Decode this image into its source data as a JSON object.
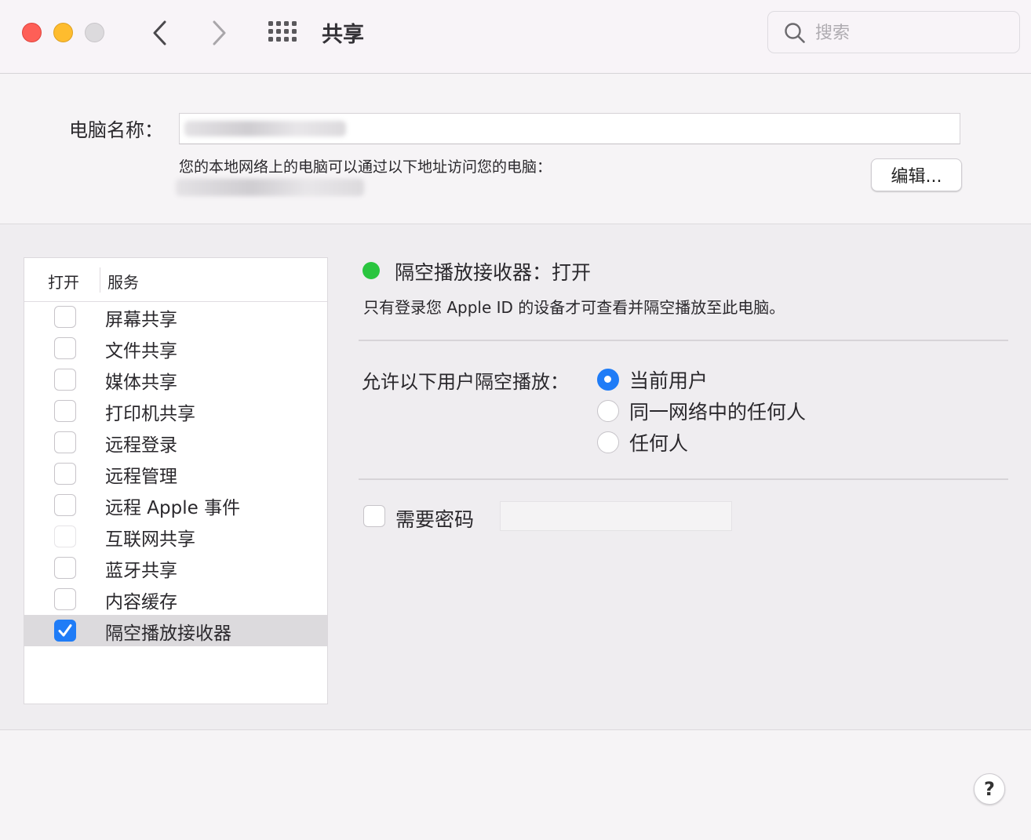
{
  "window": {
    "title": "共享",
    "search_placeholder": "搜索"
  },
  "computer_name": {
    "label": "电脑名称：",
    "value": "",
    "address_note": "您的本地网络上的电脑可以通过以下地址访问您的电脑：",
    "edit_button": "编辑..."
  },
  "services": {
    "header_on": "打开",
    "header_service": "服务",
    "items": [
      {
        "label": "屏幕共享",
        "checked": false,
        "faded": false,
        "selected": false
      },
      {
        "label": "文件共享",
        "checked": false,
        "faded": false,
        "selected": false
      },
      {
        "label": "媒体共享",
        "checked": false,
        "faded": false,
        "selected": false
      },
      {
        "label": "打印机共享",
        "checked": false,
        "faded": false,
        "selected": false
      },
      {
        "label": "远程登录",
        "checked": false,
        "faded": false,
        "selected": false
      },
      {
        "label": "远程管理",
        "checked": false,
        "faded": false,
        "selected": false
      },
      {
        "label": "远程 Apple 事件",
        "checked": false,
        "faded": false,
        "selected": false
      },
      {
        "label": "互联网共享",
        "checked": false,
        "faded": true,
        "selected": false
      },
      {
        "label": "蓝牙共享",
        "checked": false,
        "faded": false,
        "selected": false
      },
      {
        "label": "内容缓存",
        "checked": false,
        "faded": false,
        "selected": false
      },
      {
        "label": "隔空播放接收器",
        "checked": true,
        "faded": false,
        "selected": true
      }
    ]
  },
  "detail": {
    "status_title": "隔空播放接收器：打开",
    "status_color": "#2ac53f",
    "description": "只有登录您 Apple ID 的设备才可查看并隔空播放至此电脑。",
    "allow_label": "允许以下用户隔空播放：",
    "options": [
      {
        "label": "当前用户",
        "selected": true
      },
      {
        "label": "同一网络中的任何人",
        "selected": false
      },
      {
        "label": "任何人",
        "selected": false
      }
    ],
    "require_password_label": "需要密码",
    "require_password_checked": false
  },
  "help_button": "?",
  "colors": {
    "accent": "#1f7cf7",
    "close": "#fe5f57",
    "minimize": "#febc2e",
    "zoom_inactive": "#dcdadd"
  },
  "icons": {
    "back": "chevron-left-icon",
    "forward": "chevron-right-icon",
    "show_all": "grid-icon",
    "search": "search-icon",
    "check": "checkmark-icon"
  }
}
